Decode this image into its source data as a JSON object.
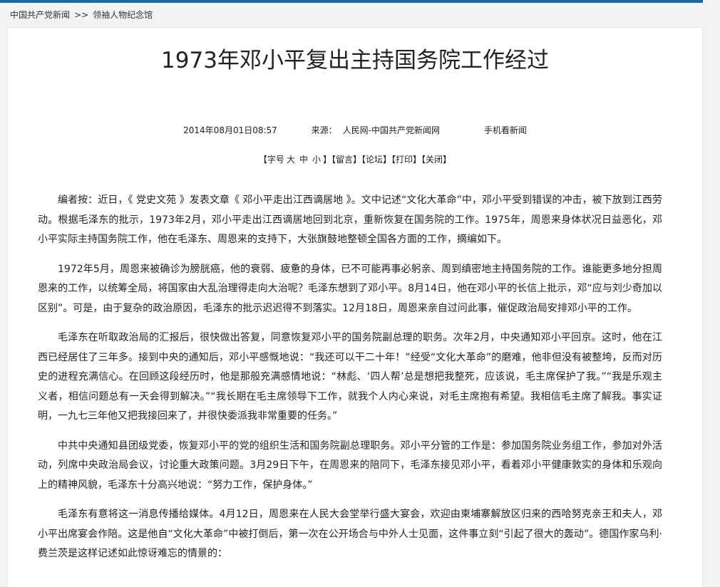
{
  "breadcrumb": {
    "items": [
      "中国共产党新闻",
      "领袖人物纪念馆"
    ],
    "separator": ">>"
  },
  "article": {
    "title": "1973年邓小平复出主持国务院工作经过",
    "meta": {
      "datetime": "2014年08月01日08:57",
      "source_label": "来源：",
      "source": "人民网-中国共产党新闻网",
      "mobile": "手机看新闻"
    },
    "tools": {
      "font_size_open": "【字号",
      "size_large": "大",
      "size_medium": "中",
      "size_small": "小",
      "font_size_close": "】",
      "comment": "【留言】",
      "forum": "【论坛】",
      "print": "【打印】",
      "close": "【关闭】"
    },
    "paragraphs": [
      "编者按：近日，《 党史文苑 》发表文章《 邓小平走出江西谪居地 》。文中记述“文化大革命”中，邓小平受到错误的冲击，被下放到江西劳动。根据毛泽东的批示，1973年2月，邓小平走出江西谪居地回到北京，重新恢复在国务院的工作。1975年，周恩来身体状况日益恶化，邓小平实际主持国务院工作，他在毛泽东、周恩来的支持下，大张旗鼓地整顿全国各方面的工作，摘编如下。",
      "1972年5月，周恩来被确诊为膀胱癌，他的衰弱、疲惫的身体，已不可能再事必躬亲、周到缜密地主持国务院的工作。谁能更多地分担周恩来的工作，以统筹全局，将国家由大乱治理得走向大治呢？毛泽东想到了邓小平。8月14日，他在邓小平的长信上批示，邓“应与刘少奇加以区别”。可是，由于复杂的政治原因，毛泽东的批示迟迟得不到落实。12月18日，周恩来亲自过问此事，催促政治局安排邓小平的工作。",
      "毛泽东在听取政治局的汇报后，很快做出答复，同意恢复邓小平的国务院副总理的职务。次年2月，中央通知邓小平回京。这时，他在江西已经居住了三年多。接到中央的通知后，邓小平感慨地说：“我还可以干二十年！”经受“文化大革命”的磨难，他非但没有被整垮，反而对历史的进程充满信心。在回顾这段经历时，他是那般充满感情地说：“林彪、‘四人帮’总是想把我整死，应该说，毛主席保护了我。”“我是乐观主义者，相信问题总有一天会得到解决。”“我长期在毛主席领导下工作，就我个人内心来说，对毛主席抱有希望。我相信毛主席了解我。事实证明，一九七三年他又把我接回来了，并很快委派我非常重要的任务。”",
      "中共中央通知县团级党委，恢复邓小平的党的组织生活和国务院副总理职务。邓小平分管的工作是：参加国务院业务组工作，参加对外活动，列席中央政治局会议，讨论重大政策问题。3月29日下午，在周恩来的陪同下，毛泽东接见邓小平，看着邓小平健康敦实的身体和乐观向上的精神风貌，毛泽东十分高兴地说：“努力工作，保护身体。”",
      "毛泽东有意将这一消息传播给媒体。4月12日，周恩来在人民大会堂举行盛大宴会，欢迎由柬埔寨解放区归来的西哈努克亲王和夫人，邓小平出席宴会作陪。这是他自“文化大革命”中被打倒后，第一次在公开场合与中外人士见面，这件事立刻“引起了很大的轰动”。德国作家乌利·费兰茨是这样记述如此惊讶难忘的情景的："
    ]
  },
  "colors": {
    "top_bar": "#1a6aa8",
    "page_background": "#f3f3f3",
    "content_background": "#ffffff"
  }
}
